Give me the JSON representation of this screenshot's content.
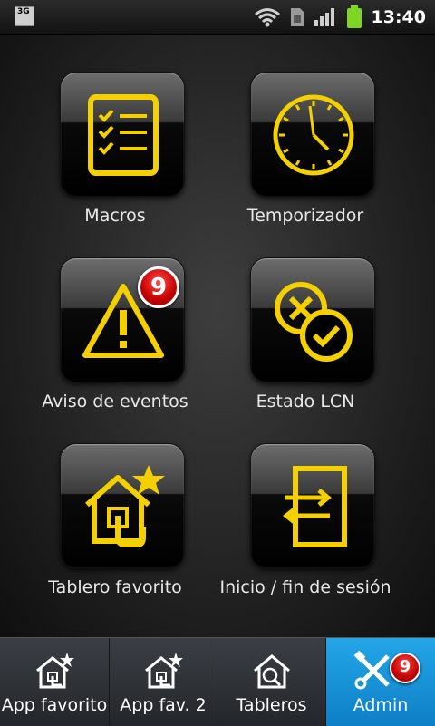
{
  "status_bar": {
    "network_badge": "3G",
    "time": "13:40",
    "icons": [
      "wifi-icon",
      "sim-icon",
      "signal-icon",
      "battery-icon"
    ]
  },
  "grid": {
    "items": [
      {
        "label": "Macros",
        "icon": "checklist-icon"
      },
      {
        "label": "Temporizador",
        "icon": "clock-icon"
      },
      {
        "label": "Aviso de eventos",
        "icon": "warning-icon",
        "badge": "9"
      },
      {
        "label": "Estado LCN",
        "icon": "status-x-check-icon"
      },
      {
        "label": "Tablero favorito",
        "icon": "favorite-house-icon"
      },
      {
        "label": "Inicio / fin de sesión",
        "icon": "login-logout-icon"
      }
    ]
  },
  "tabs": [
    {
      "label": "App favorito",
      "icon": "favorite-house-icon"
    },
    {
      "label": "App fav. 2",
      "icon": "favorite-house-icon"
    },
    {
      "label": "Tableros",
      "icon": "house-search-icon"
    },
    {
      "label": "Admin",
      "icon": "tools-icon",
      "badge": "9",
      "active": true
    }
  ],
  "colors": {
    "accent_yellow": "#f5d000",
    "active_tab": "#1a9ae0",
    "badge_red": "#d10000"
  }
}
